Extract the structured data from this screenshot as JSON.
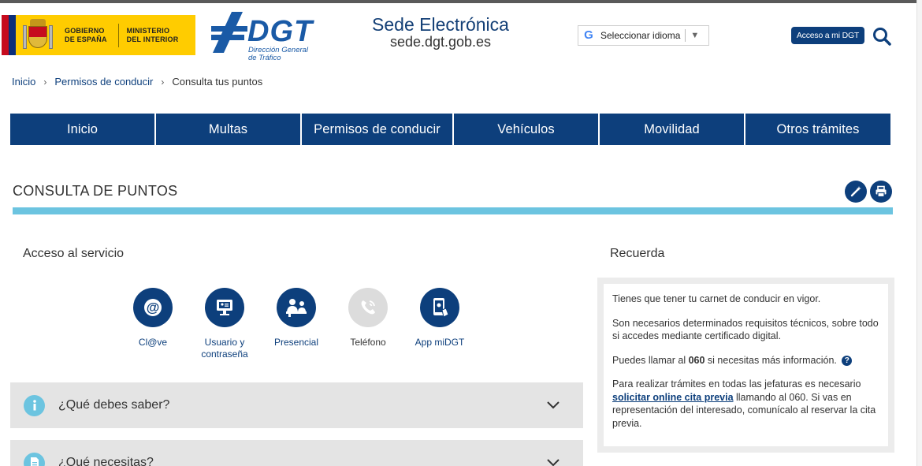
{
  "header": {
    "gov_line1": "GOBIERNO",
    "gov_line2": "DE ESPAÑA",
    "ministry_line1": "MINISTERIO",
    "ministry_line2": "DEL INTERIOR",
    "dgt_logo": "DGT",
    "dgt_sub1": "Dirección General",
    "dgt_sub2": "de Tráfico",
    "sede_title": "Sede Electrónica",
    "sede_url": "sede.dgt.gob.es",
    "language_select": "Seleccionar idioma",
    "access_button": "Acceso a mi DGT",
    "search_icon": "search-icon"
  },
  "breadcrumb": {
    "items": [
      "Inicio",
      "Permisos de conducir",
      "Consulta tus puntos"
    ]
  },
  "nav": {
    "items": [
      "Inicio",
      "Multas",
      "Permisos de conducir",
      "Vehículos",
      "Movilidad",
      "Otros trámites"
    ]
  },
  "page": {
    "title": "CONSULTA DE PUNTOS",
    "tools": [
      "magic-wand-icon",
      "print-icon"
    ]
  },
  "access": {
    "heading": "Acceso al servicio",
    "options": [
      {
        "label": "Cl@ve",
        "icon": "at-sign-icon"
      },
      {
        "label": "Usuario y contraseña",
        "icon": "computer-user-icon"
      },
      {
        "label": "Presencial",
        "icon": "in-person-icon"
      },
      {
        "label": "Teléfono",
        "icon": "phone-icon"
      },
      {
        "label": "App miDGT",
        "icon": "mobile-app-icon"
      }
    ]
  },
  "accordions": [
    {
      "label": "¿Qué debes saber?",
      "icon": "info-icon"
    },
    {
      "label": "¿Qué necesitas?",
      "icon": "document-icon"
    }
  ],
  "recuerda": {
    "heading": "Recuerda",
    "p1": "Tienes que tener tu carnet de conducir en vigor.",
    "p2": "Son necesarios determinados requisitos técnicos, sobre todo si accedes mediante certificado digital.",
    "p3_before": "Puedes llamar al ",
    "p3_number": "060",
    "p3_after": " si necesitas más información.",
    "p4_before": "Para realizar trámites en todas las jefaturas es necesario ",
    "p4_link": "solicitar online cita previa",
    "p4_after": " llamando al 060. Si vas en representación del interesado, comunícalo al reservar la cita previa."
  },
  "colors": {
    "primary": "#0d3f7c",
    "accent": "#6cc4e0",
    "panel": "#e4e4e4"
  }
}
